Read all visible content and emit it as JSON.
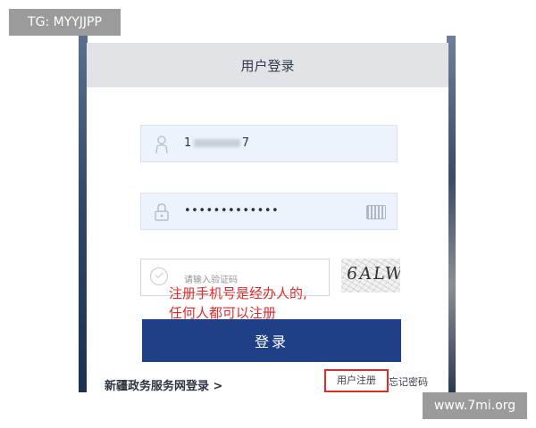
{
  "watermarks": {
    "top_left": "TG: MYYJJPP",
    "bottom_right": "www.7mi.org"
  },
  "login": {
    "title": "用户登录",
    "username": {
      "icon": "user-icon",
      "value_prefix": "1",
      "value_suffix": "7"
    },
    "password": {
      "icon": "lock-icon",
      "value": "•••••••••••••",
      "keyboard_icon": "keyboard-icon"
    },
    "captcha": {
      "placeholder": "请输入验证码",
      "icon": "check-circle-icon",
      "image_text": "6ALW"
    },
    "submit_label": "登录",
    "portal_link": "新疆政务服务网登录 >",
    "register_link": "用户注册",
    "forgot_link": "忘记密码"
  },
  "annotation": {
    "line1": "注册手机号是经办人的,",
    "line2": "任何人都可以注册"
  },
  "colors": {
    "primary": "#1f3f86",
    "annotation_red": "#e02a2a",
    "input_bg": "#edf3fd",
    "header_bg": "#e1e3e7"
  }
}
